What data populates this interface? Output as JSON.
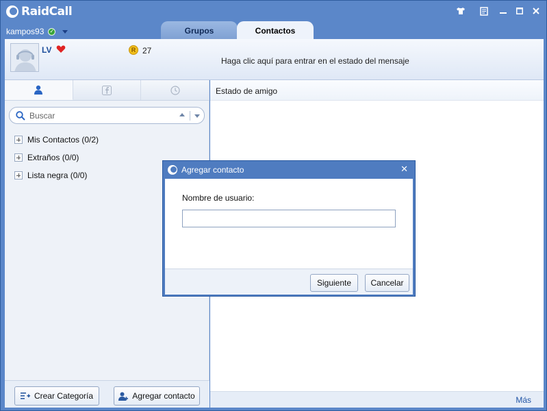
{
  "app": {
    "name": "RaidCall"
  },
  "user": {
    "username": "kampos93",
    "nick": "LV",
    "coins": "27",
    "status_message_prompt": "Haga clic aquí para entrar en el estado del mensaje"
  },
  "tabs": [
    {
      "label": "Grupos"
    },
    {
      "label": "Contactos"
    }
  ],
  "search": {
    "placeholder": "Buscar"
  },
  "groups": [
    {
      "label": "Mis Contactos (0/2)"
    },
    {
      "label": "Extraños (0/0)"
    },
    {
      "label": "Lista negra (0/0)"
    }
  ],
  "left_footer": {
    "create_category": "Crear Categoría",
    "add_contact": "Agregar contacto"
  },
  "right_panel": {
    "header": "Estado de amigo",
    "more": "Más"
  },
  "dialog": {
    "title": "Agregar contacto",
    "field_label": "Nombre de usuario:",
    "field_value": "",
    "next": "Siguiente",
    "cancel": "Cancelar"
  },
  "colors": {
    "frame": "#5b87c9",
    "accent": "#2356a6",
    "online": "#3aa53a",
    "coin": "#f2c01c"
  }
}
